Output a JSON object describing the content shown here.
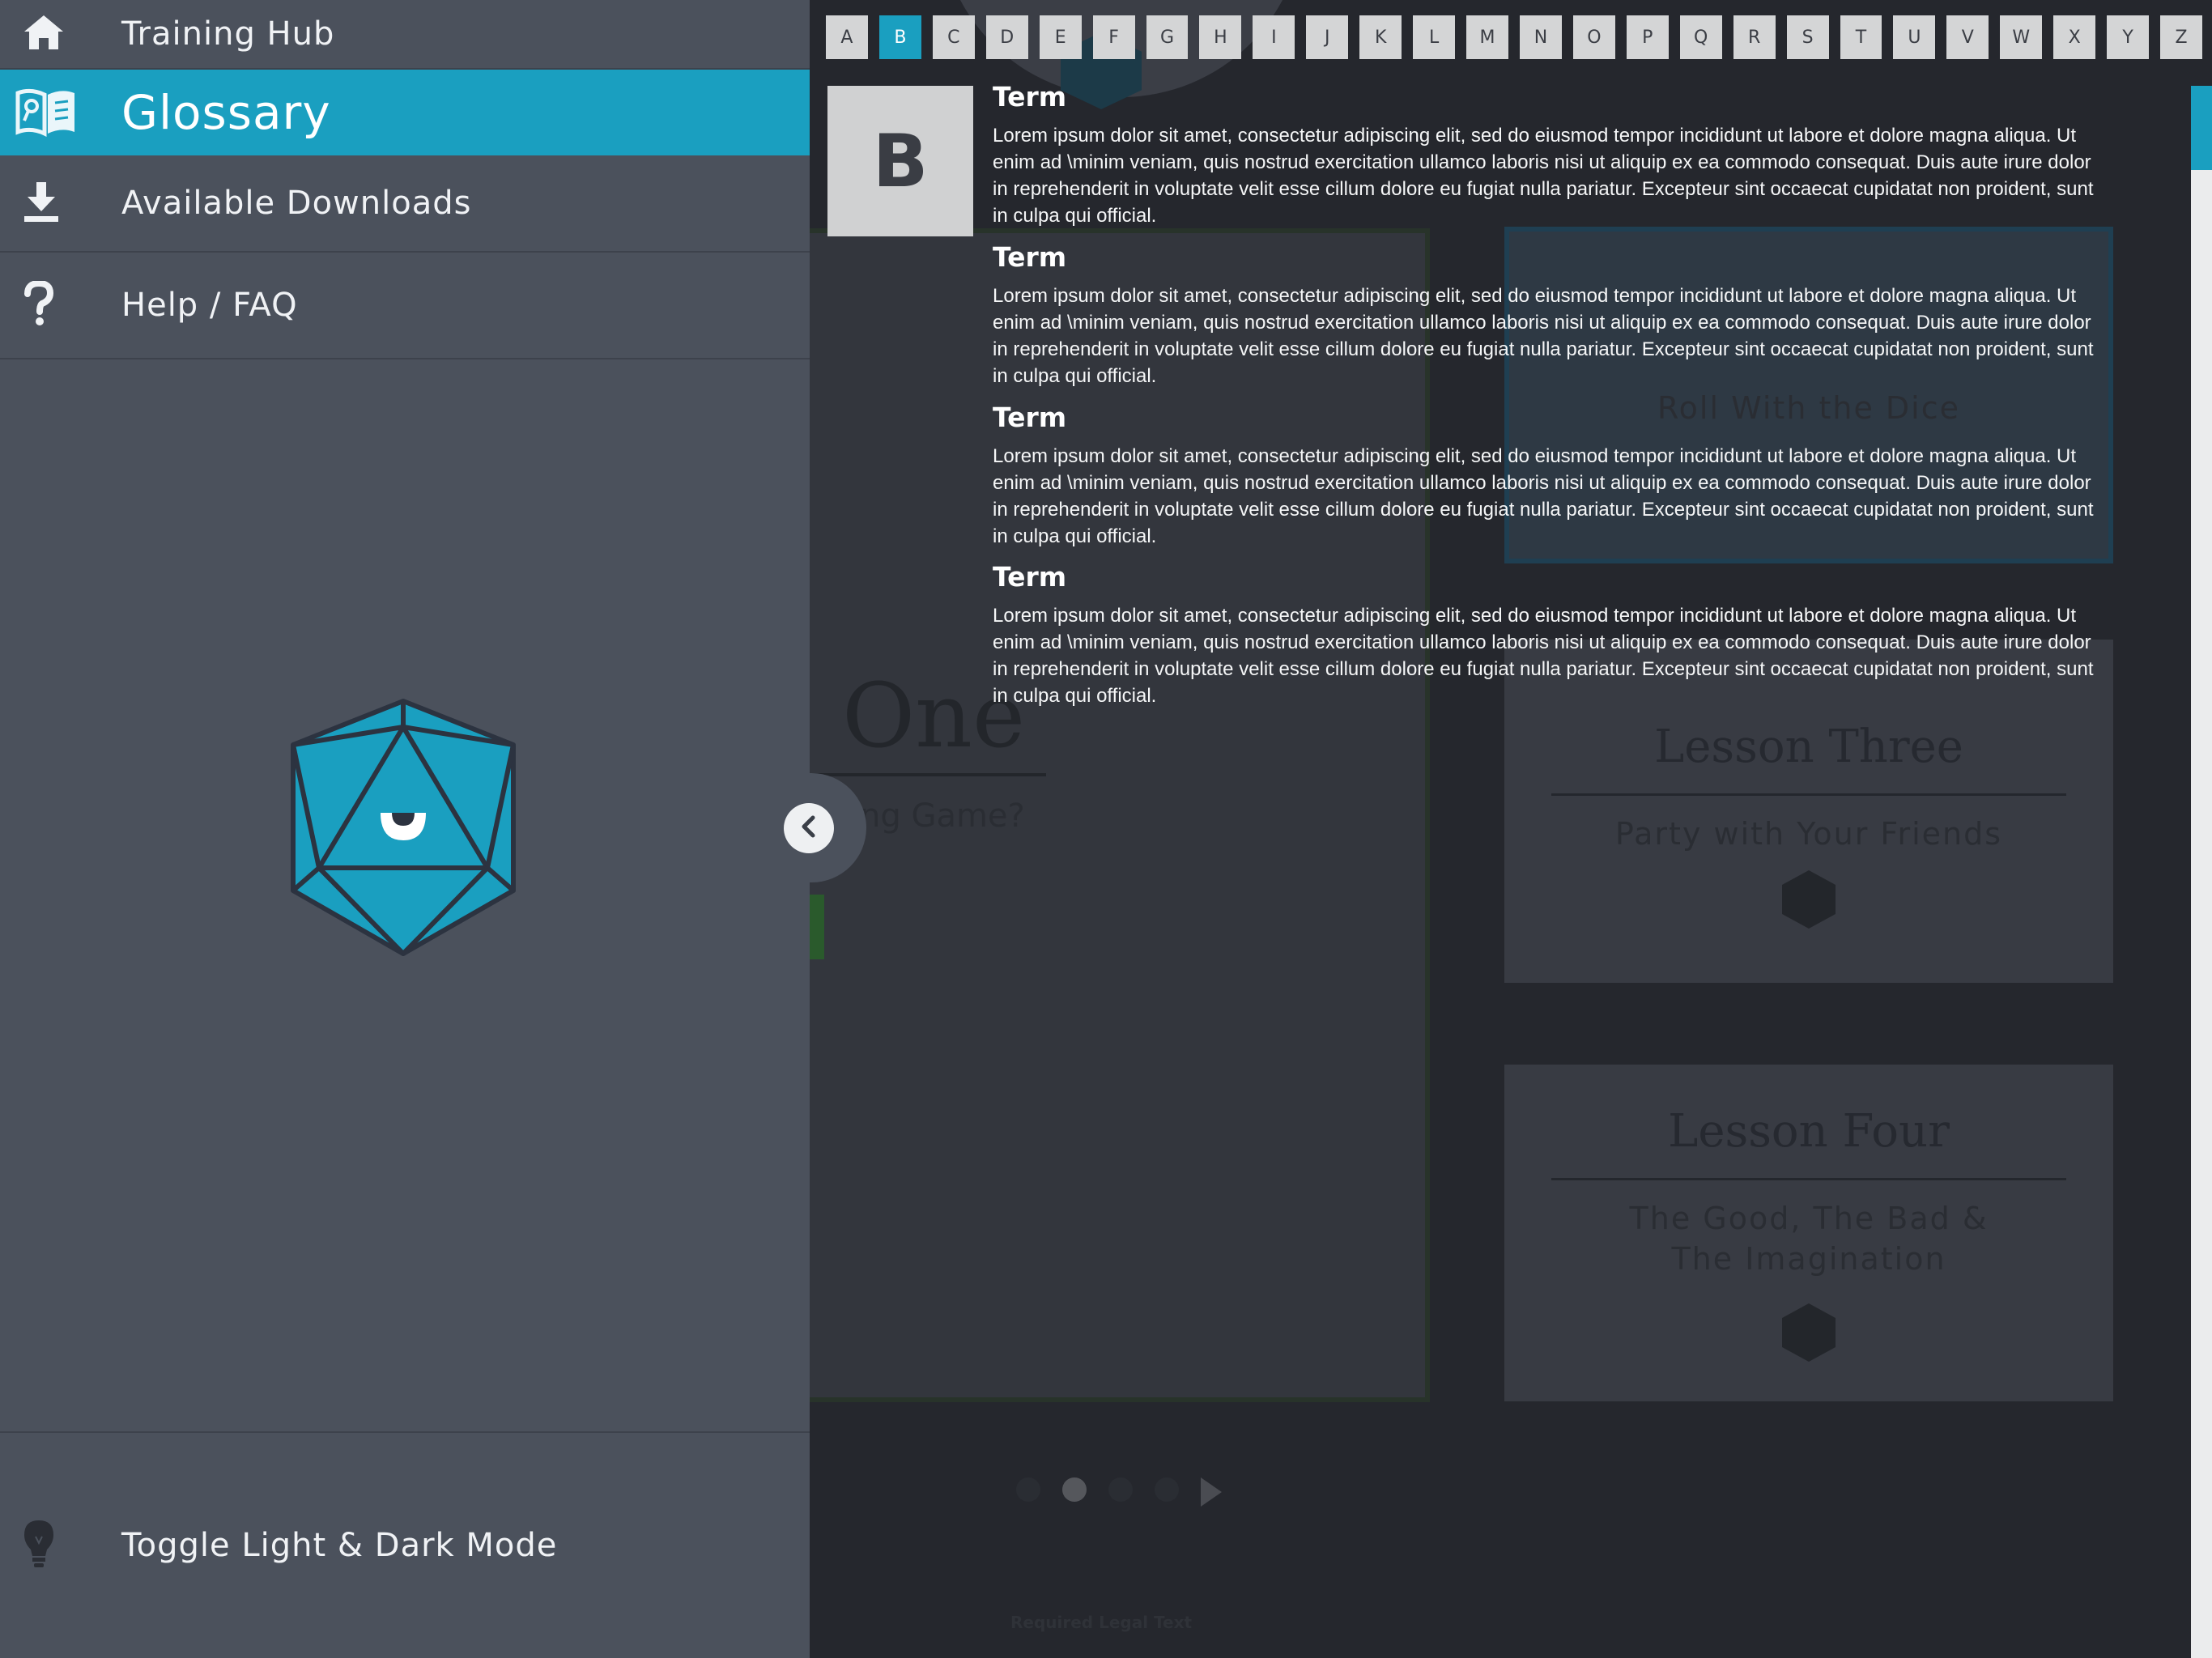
{
  "background": {
    "lessons": [
      {
        "title": "One",
        "subtitle": "ng Game?"
      },
      {
        "title": "",
        "subtitle": "Roll With the Dice"
      },
      {
        "title": "Lesson Three",
        "subtitle": "Party with Your Friends"
      },
      {
        "title": "Lesson Four",
        "subtitle_line1": "The Good, The Bad &",
        "subtitle_line2": "The Imagination"
      }
    ],
    "legal": "Required Legal Text"
  },
  "sidebar": {
    "items": [
      {
        "label": "Training Hub",
        "icon": "home-icon"
      },
      {
        "label": "Glossary",
        "icon": "book-icon"
      },
      {
        "label": "Available Downloads",
        "icon": "download-icon"
      },
      {
        "label": "Help / FAQ",
        "icon": "question-icon"
      }
    ],
    "toggle": {
      "label": "Toggle Light & Dark Mode",
      "icon": "lightbulb-icon"
    },
    "logo": "d20-logo-icon"
  },
  "alphabet": [
    "A",
    "B",
    "C",
    "D",
    "E",
    "F",
    "G",
    "H",
    "I",
    "J",
    "K",
    "L",
    "M",
    "N",
    "O",
    "P",
    "Q",
    "R",
    "S",
    "T",
    "U",
    "V",
    "W",
    "X",
    "Y",
    "Z"
  ],
  "alphabet_active": "B",
  "glossary": {
    "current_letter": "B",
    "entries": [
      {
        "term": "Term",
        "definition": "Lorem ipsum dolor sit amet, consectetur adipiscing elit, sed do eiusmod tempor incididunt ut labore et dolore magna aliqua. Ut enim ad \\minim veniam, quis nostrud exercitation ullamco laboris nisi ut aliquip ex ea commodo consequat. Duis aute irure dolor in reprehenderit in voluptate velit esse cillum dolore eu fugiat nulla pariatur. Excepteur sint occaecat cupidatat non proident, sunt in culpa qui official."
      },
      {
        "term": "Term",
        "definition": "Lorem ipsum dolor sit amet, consectetur adipiscing elit, sed do eiusmod tempor incididunt ut labore et dolore magna aliqua. Ut enim ad \\minim veniam, quis nostrud exercitation ullamco laboris nisi ut aliquip ex ea commodo consequat. Duis aute irure dolor in reprehenderit in voluptate velit esse cillum dolore eu fugiat nulla pariatur. Excepteur sint occaecat cupidatat non proident, sunt in culpa qui official."
      },
      {
        "term": "Term",
        "definition": "Lorem ipsum dolor sit amet, consectetur adipiscing elit, sed do eiusmod tempor incididunt ut labore et dolore magna aliqua. Ut enim ad \\minim veniam, quis nostrud exercitation ullamco laboris nisi ut aliquip ex ea commodo consequat. Duis aute irure dolor in reprehenderit in voluptate velit esse cillum dolore eu fugiat nulla pariatur. Excepteur sint occaecat cupidatat non proident, sunt in culpa qui official."
      },
      {
        "term": "Term",
        "definition": "Lorem ipsum dolor sit amet, consectetur adipiscing elit, sed do eiusmod tempor incididunt ut labore et dolore magna aliqua. Ut enim ad \\minim veniam, quis nostrud exercitation ullamco laboris nisi ut aliquip ex ea commodo consequat. Duis aute irure dolor in reprehenderit in voluptate velit esse cillum dolore eu fugiat nulla pariatur. Excepteur sint occaecat cupidatat non proident, sunt in culpa qui official."
      }
    ]
  },
  "colors": {
    "accent": "#1a9fc0",
    "sidebar": "#4b515c",
    "background": "#25272d",
    "letter_tile": "#d4d5d6"
  }
}
